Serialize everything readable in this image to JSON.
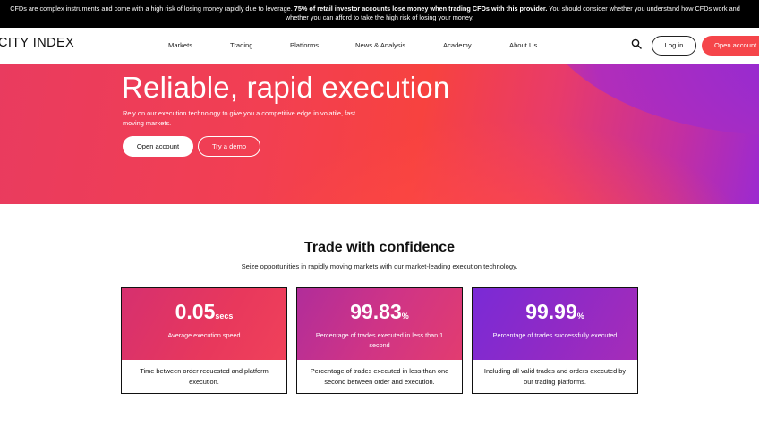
{
  "risk_warning": {
    "part1": "CFDs are complex instruments and come with a high risk of losing money rapidly due to leverage. ",
    "bold": "75% of retail investor accounts lose money when trading CFDs with this provider.",
    "part2": " You should consider whether you understand how CFDs work and",
    "line2": "whether you can afford to take the high risk of losing your money."
  },
  "header": {
    "logo": "CITY INDEX",
    "nav": [
      "Markets",
      "Trading",
      "Platforms",
      "News & Analysis",
      "Academy",
      "About Us"
    ],
    "search_icon": "search-icon",
    "login_label": "Log in",
    "open_account_label": "Open account"
  },
  "hero": {
    "title": "Reliable, rapid execution",
    "subtitle": "Rely on our execution technology to give you a competitive edge in volatile, fast moving markets.",
    "open_account_label": "Open account",
    "demo_label": "Try a demo"
  },
  "section": {
    "title": "Trade with confidence",
    "subtitle": "Seize opportunities in rapidly moving markets with our market-leading execution technology."
  },
  "cards": [
    {
      "value": "0.05",
      "unit": "secs",
      "label": "Average execution speed",
      "description": "Time between order requested and platform execution."
    },
    {
      "value": "99.83",
      "unit": "%",
      "label": "Percentage of trades executed in less than 1 second",
      "description": "Percentage of trades executed in less than one second between order and execution."
    },
    {
      "value": "99.99",
      "unit": "%",
      "label": "Percentage of trades successfully executed",
      "description": "Including all valid trades and orders executed by our trading platforms."
    }
  ],
  "colors": {
    "brand_red": "#f5454a",
    "hero_purple": "#9c2ad0"
  }
}
